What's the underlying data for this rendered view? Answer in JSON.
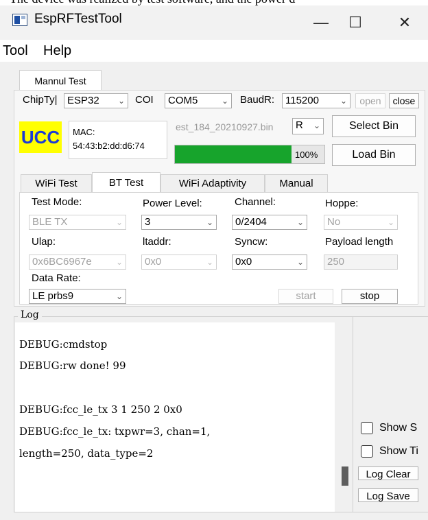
{
  "top_caption": "The device was realized by test software, and the power d",
  "window": {
    "title": "EspRFTestTool",
    "minimize": "—",
    "maximize": "☐",
    "close": "✕"
  },
  "menu": {
    "items": [
      "Tool",
      "Help"
    ]
  },
  "outer_tab": "Mannul Test",
  "conn": {
    "chip_label": "ChipTy|",
    "chip_value": "ESP32",
    "com_label": "COI",
    "com_value": "COM5",
    "baud_label": "BaudR:",
    "baud_value": "115200",
    "open_label": "open",
    "close_label": "close"
  },
  "device": {
    "logo": "UCC",
    "mac_label": "MAC:",
    "mac_value": "54:43:b2:dd:d6:74",
    "bin_file": "est_184_20210927.bin",
    "mode_value": "R",
    "select_bin": "Select Bin",
    "load_bin": "Load Bin",
    "progress_percent": 100,
    "progress_text": "100%"
  },
  "inner_tabs": [
    "WiFi Test",
    "BT Test",
    "WiFi Adaptivity",
    "Manual"
  ],
  "bt": {
    "test_mode_label": "Test Mode:",
    "test_mode_value": "BLE TX",
    "power_level_label": "Power Level:",
    "power_level_value": "3",
    "channel_label": "Channel:",
    "channel_value": "0/2404",
    "hoppe_label": "Hoppe:",
    "hoppe_value": "No",
    "ulap_label": "Ulap:",
    "ulap_value": "0x6BC6967e",
    "ltaddr_label": "ltaddr:",
    "ltaddr_value": "0x0",
    "syncw_label": "Syncw:",
    "syncw_value": "0x0",
    "payload_label": "Payload length",
    "payload_value": "250",
    "data_rate_label": "Data Rate:",
    "data_rate_value": "LE prbs9",
    "start": "start",
    "stop": "stop"
  },
  "log": {
    "title": "Log",
    "lines": [
      "DEBUG:cmdstop",
      "DEBUG:rw done! 99",
      "",
      "DEBUG:fcc_le_tx 3 1 250 2 0x0",
      "DEBUG:fcc_le_tx: txpwr=3, chan=1,",
      "length=250, data_type=2"
    ],
    "show_s": "Show S",
    "show_ti": "Show Ti",
    "clear": "Log Clear",
    "save": "Log Save"
  },
  "colors": {
    "progress": "#17a42c",
    "logo_bg": "#ffff00",
    "logo_fg": "#1a3ad6"
  }
}
